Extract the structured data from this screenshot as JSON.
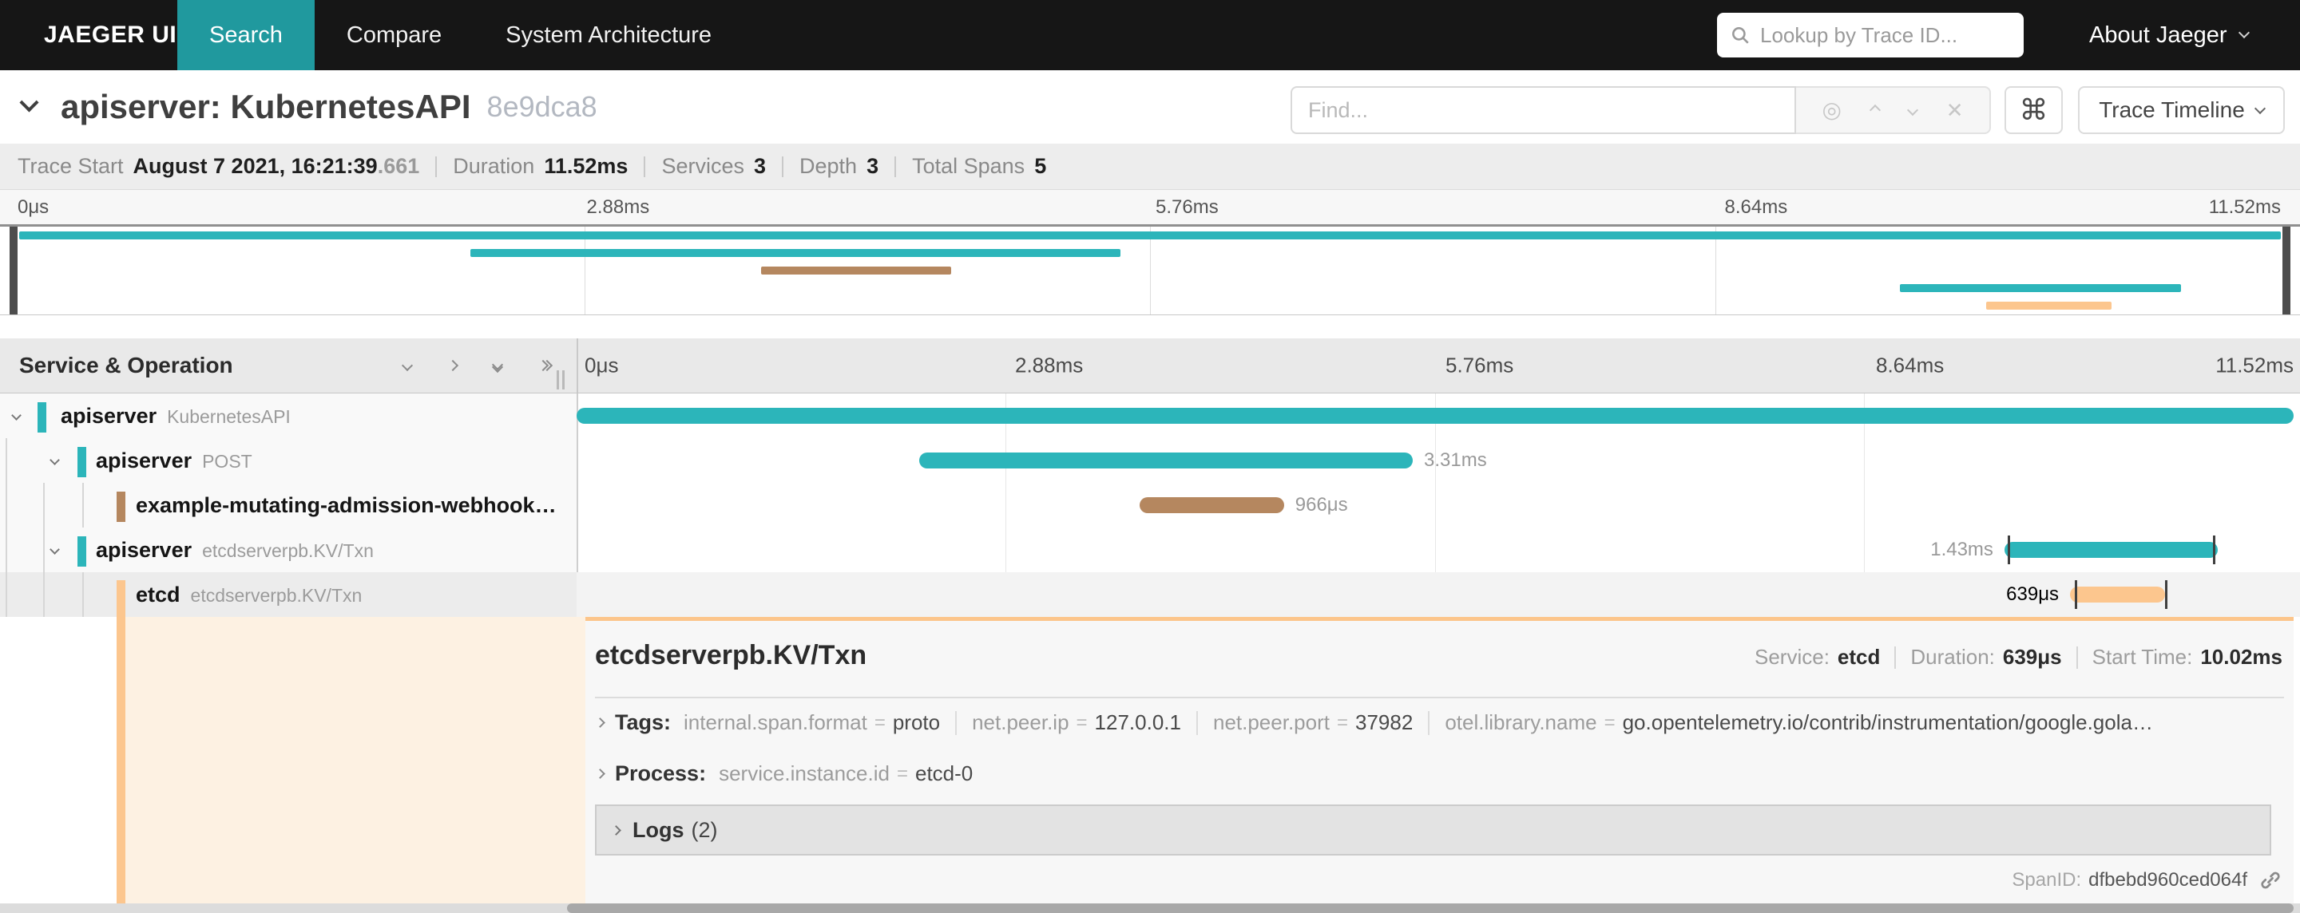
{
  "nav": {
    "brand": "JAEGER UI",
    "tabs": [
      {
        "label": "Search",
        "active": true
      },
      {
        "label": "Compare",
        "active": false
      },
      {
        "label": "System Architecture",
        "active": false
      }
    ],
    "lookup_placeholder": "Lookup by Trace ID...",
    "about": "About Jaeger"
  },
  "trace_header": {
    "title": "apiserver: KubernetesAPI",
    "trace_id": "8e9dca8",
    "find_placeholder": "Find...",
    "view_selector": "Trace Timeline"
  },
  "summary": {
    "items": [
      {
        "label": "Trace Start",
        "value": "August 7 2021, 16:21:39",
        "suffix": ".661"
      },
      {
        "label": "Duration",
        "value": "11.52ms"
      },
      {
        "label": "Services",
        "value": "3"
      },
      {
        "label": "Depth",
        "value": "3"
      },
      {
        "label": "Total Spans",
        "value": "5"
      }
    ]
  },
  "timeline": {
    "duration_ms": 11.52,
    "ticks": [
      "0μs",
      "2.88ms",
      "5.76ms",
      "8.64ms",
      "11.52ms"
    ],
    "left_header": "Service & Operation",
    "rows": [
      {
        "service": "apiserver",
        "operation": "KubernetesAPI",
        "depth": 0,
        "color": "#2cb5ba",
        "start_ms": 0,
        "duration_ms": 11.52,
        "label": "",
        "has_children": true
      },
      {
        "service": "apiserver",
        "operation": "POST",
        "depth": 1,
        "color": "#2cb5ba",
        "start_ms": 2.3,
        "duration_ms": 3.31,
        "label": "3.31ms",
        "label_side": "right",
        "has_children": true
      },
      {
        "service": "example-mutating-admission-webhook…",
        "operation": "",
        "depth": 2,
        "color": "#b5875f",
        "start_ms": 3.78,
        "duration_ms": 0.966,
        "label": "966μs",
        "label_side": "right",
        "has_children": false
      },
      {
        "service": "apiserver",
        "operation": "etcdserverpb.KV/Txn",
        "depth": 1,
        "color": "#2cb5ba",
        "start_ms": 9.58,
        "duration_ms": 1.43,
        "label": "1.43ms",
        "label_side": "left",
        "has_children": true,
        "log_ticks_ms": [
          9.6,
          10.98
        ]
      },
      {
        "service": "etcd",
        "operation": "etcdserverpb.KV/Txn",
        "depth": 2,
        "color": "#fcc68e",
        "start_ms": 10.02,
        "duration_ms": 0.639,
        "label": "639μs",
        "label_side": "left",
        "has_children": false,
        "selected": true,
        "log_ticks_ms": [
          10.05,
          10.66
        ]
      }
    ]
  },
  "detail": {
    "title": "etcdserverpb.KV/Txn",
    "meta": [
      {
        "label": "Service:",
        "value": "etcd"
      },
      {
        "label": "Duration:",
        "value": "639μs"
      },
      {
        "label": "Start Time:",
        "value": "10.02ms"
      }
    ],
    "tags_label": "Tags:",
    "tags": [
      {
        "key": "internal.span.format",
        "value": "proto"
      },
      {
        "key": "net.peer.ip",
        "value": "127.0.0.1"
      },
      {
        "key": "net.peer.port",
        "value": "37982"
      },
      {
        "key": "otel.library.name",
        "value": "go.opentelemetry.io/contrib/instrumentation/google.gola…"
      }
    ],
    "process_label": "Process:",
    "process": [
      {
        "key": "service.instance.id",
        "value": "etcd-0"
      }
    ],
    "logs_label": "Logs",
    "logs_count": "(2)",
    "spanid_label": "SpanID:",
    "spanid": "dfbebd960ced064f"
  },
  "colors": {
    "teal": "#2cb5ba",
    "brown": "#b5875f",
    "orange": "#fcc68e",
    "nav_active": "#20999e",
    "detail_peach": "#fdf1e2"
  }
}
